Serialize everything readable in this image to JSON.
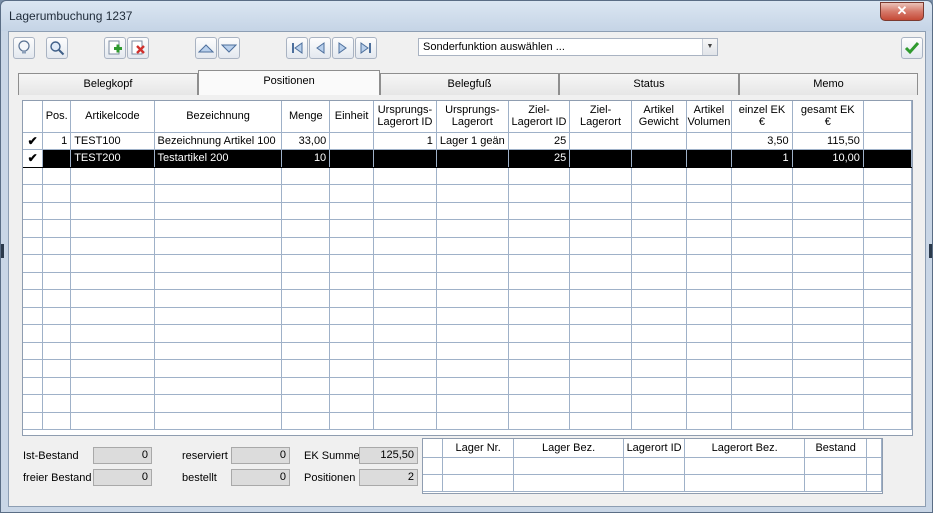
{
  "window": {
    "title": "Lagerumbuchung 1237",
    "close_glyph": "✕"
  },
  "toolbar": {
    "buttons": [
      {
        "name": "lightbulb-icon"
      },
      {
        "name": "search-icon"
      },
      {
        "name": "add-document-icon"
      },
      {
        "name": "delete-document-icon"
      },
      {
        "name": "arrow-up-icon"
      },
      {
        "name": "arrow-down-icon"
      },
      {
        "name": "first-record-icon"
      },
      {
        "name": "previous-record-icon"
      },
      {
        "name": "next-record-icon"
      },
      {
        "name": "last-record-icon"
      },
      {
        "name": "confirm-check-icon"
      }
    ],
    "special_function_select": "Sonderfunktion auswählen ..."
  },
  "tabs": [
    "Belegkopf",
    "Positionen",
    "Belegfuß",
    "Status",
    "Memo"
  ],
  "active_tab": "Positionen",
  "grid": {
    "columns": [
      "",
      "Pos.",
      "Artikelcode",
      "Bezeichnung",
      "Menge",
      "Einheit",
      "Ursprungs-\nLagerort ID",
      "Ursprungs-\nLagerort",
      "Ziel-\nLagerort ID",
      "Ziel-\nLagerort",
      "Artikel\nGewicht",
      "Artikel\nVolumen",
      "einzel EK\n€",
      "gesamt EK\n€",
      ""
    ],
    "rows": [
      [
        "✔",
        "1",
        "TEST100",
        "Bezeichnung Artikel 100",
        "33,00",
        "",
        "1",
        "Lager 1 geän",
        "25",
        "",
        "",
        "",
        "3,50",
        "115,50",
        ""
      ],
      [
        "✔",
        "",
        "TEST200",
        "Testartikel 200",
        "10",
        "",
        "",
        "",
        "25",
        "",
        "",
        "",
        "1",
        "10,00",
        ""
      ]
    ],
    "selected_row": 1
  },
  "summary": {
    "ist_bestand_label": "Ist-Bestand",
    "ist_bestand_value": "0",
    "freier_bestand_label": "freier Bestand",
    "freier_bestand_value": "0",
    "reserviert_label": "reserviert",
    "reserviert_value": "0",
    "bestellt_label": "bestellt",
    "bestellt_value": "0",
    "ek_summe_label": "EK Summe",
    "ek_summe_value": "125,50",
    "positionen_label": "Positionen",
    "positionen_value": "2"
  },
  "stock_grid": {
    "columns": [
      "",
      "Lager Nr.",
      "Lager Bez.",
      "Lagerort ID",
      "Lagerort Bez.",
      "Bestand",
      ""
    ]
  }
}
